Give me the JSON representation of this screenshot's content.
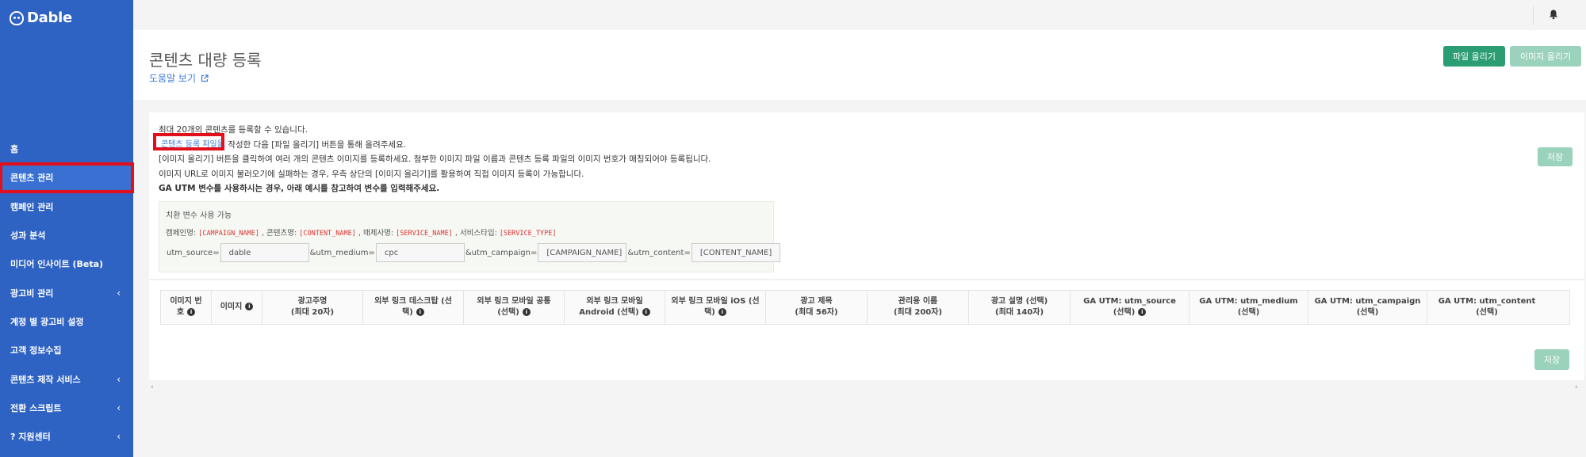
{
  "app": {
    "name": "Dable"
  },
  "sidebar": {
    "items": [
      {
        "label": "홈",
        "has_chevron": false,
        "active": false
      },
      {
        "label": "콘텐츠 관리",
        "has_chevron": false,
        "active": true
      },
      {
        "label": "캠페인 관리",
        "has_chevron": false,
        "active": false
      },
      {
        "label": "성과 분석",
        "has_chevron": false,
        "active": false
      },
      {
        "label": "미디어 인사이트 (Beta)",
        "has_chevron": false,
        "active": false
      },
      {
        "label": "광고비 관리",
        "has_chevron": true,
        "active": false
      },
      {
        "label": "계정 별 광고비 설정",
        "has_chevron": false,
        "active": false
      },
      {
        "label": "고객 정보수집",
        "has_chevron": false,
        "active": false
      },
      {
        "label": "콘텐츠 제작 서비스",
        "has_chevron": true,
        "active": false
      },
      {
        "label": "전환 스크립트",
        "has_chevron": true,
        "active": false
      },
      {
        "label": "?  지원센터",
        "has_chevron": true,
        "active": false
      }
    ],
    "chevron": "‹"
  },
  "header": {
    "title": "콘텐츠 대량 등록",
    "help_link": "도움말 보기",
    "upload_file_button": "파일 올리기",
    "upload_image_button": "이미지 올리기"
  },
  "info": {
    "line1": "최대 20개의 콘텐츠를 등록할 수 있습니다.",
    "line2_link": "콘텐츠 등록 파일을",
    "line2_rest": "작성한 다음 [파일 올리기] 버튼을 통해 올려주세요.",
    "line3": "[이미지 올리기] 버튼을 클릭하여 여러 개의 콘텐츠 이미지를 등록하세요. 첨부한 이미지 파일 이름과 콘텐츠 등록 파일의 이미지 번호가 매칭되어야 등록됩니다.",
    "line4": "이미지 URL로 이미지 불러오기에 실패하는 경우, 우측 상단의 [이미지 올리기]를 활용하여 직접 이미지 등록이 가능합니다.",
    "line5": "GA UTM 변수를 사용하시는 경우, 아래 예시를 참고하여 변수를 입력해주세요."
  },
  "save_label": "저장",
  "variables": {
    "title": "치환 변수 사용 가능",
    "items": [
      {
        "label": "캠페인명:",
        "code": "[CAMPAIGN_NAME]"
      },
      {
        "label": ", 콘텐츠명:",
        "code": "[CONTENT_NAME]"
      },
      {
        "label": ", 매체사명:",
        "code": "[SERVICE_NAME]"
      },
      {
        "label": ", 서비스타입:",
        "code": "[SERVICE_TYPE]"
      }
    ],
    "utm": [
      {
        "label": "utm_source=",
        "value": "dable"
      },
      {
        "label": "&utm_medium=",
        "value": "cpc"
      },
      {
        "label": "&utm_campaign=",
        "value": "[CAMPAIGN_NAME]"
      },
      {
        "label": "&utm_content=",
        "value": "[CONTENT_NAME]"
      }
    ]
  },
  "table": {
    "headers": [
      {
        "lines": [
          "이미지 번",
          "호"
        ],
        "info": true
      },
      {
        "lines": [
          "이미지"
        ],
        "info": true
      },
      {
        "lines": [
          "광고주명",
          "(최대 20자)"
        ],
        "info": false
      },
      {
        "lines": [
          "외부 링크 데스크탑 (선",
          "택)"
        ],
        "info": true
      },
      {
        "lines": [
          "외부 링크 모바일 공통",
          "(선택)"
        ],
        "info": true
      },
      {
        "lines": [
          "외부 링크 모바일",
          "Android (선택)"
        ],
        "info": true
      },
      {
        "lines": [
          "외부 링크 모바일 iOS (선",
          "택)"
        ],
        "info": true
      },
      {
        "lines": [
          "광고 제목",
          "(최대 56자)"
        ],
        "info": false
      },
      {
        "lines": [
          "관리용 이름",
          "(최대 200자)"
        ],
        "info": false
      },
      {
        "lines": [
          "광고 설명 (선택)",
          "(최대 140자)"
        ],
        "info": false
      },
      {
        "lines": [
          "GA UTM: utm_source",
          "(선택)"
        ],
        "info": true
      },
      {
        "lines": [
          "GA UTM: utm_medium",
          "(선택)"
        ],
        "info": false
      },
      {
        "lines": [
          "GA UTM: utm_campaign",
          "(선택)"
        ],
        "info": false
      },
      {
        "lines": [
          "GA UTM: utm_content",
          "(선택)"
        ],
        "info": false
      }
    ]
  },
  "colors": {
    "sidebar": "#2e62c3",
    "primary_green": "#2a9d73",
    "disabled_green": "#9ad2bc",
    "highlight_red": "#e20f1c",
    "link_blue": "#3c7bd8"
  }
}
